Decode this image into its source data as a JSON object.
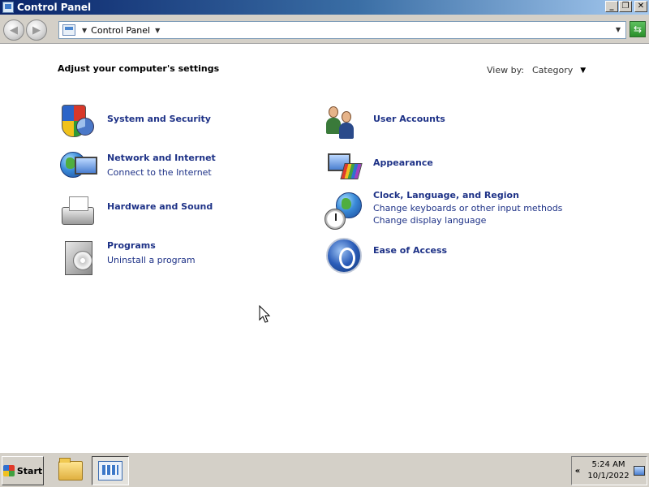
{
  "window": {
    "title": "Control Panel",
    "buttons": {
      "minimize": "_",
      "maximize": "❐",
      "close": "✕"
    }
  },
  "address": {
    "path": "Control Panel",
    "back_icon": "back-arrow-icon",
    "forward_icon": "forward-arrow-icon",
    "refresh_icon": "refresh-icon"
  },
  "content": {
    "heading": "Adjust your computer's settings",
    "view_by_label": "View by:",
    "view_by_value": "Category",
    "categories_left": [
      {
        "title": "System and Security",
        "links": [],
        "icon": "shield-icon"
      },
      {
        "title": "Network and Internet",
        "links": [
          "Connect to the Internet"
        ],
        "icon": "network-globe-icon"
      },
      {
        "title": "Hardware and Sound",
        "links": [],
        "icon": "printer-icon"
      },
      {
        "title": "Programs",
        "links": [
          "Uninstall a program"
        ],
        "icon": "programs-disc-icon"
      }
    ],
    "categories_right": [
      {
        "title": "User Accounts",
        "links": [],
        "icon": "users-icon"
      },
      {
        "title": "Appearance",
        "links": [],
        "icon": "appearance-palette-icon"
      },
      {
        "title": "Clock, Language, and Region",
        "links": [
          "Change keyboards or other input methods",
          "Change display language"
        ],
        "icon": "clock-globe-icon"
      },
      {
        "title": "Ease of Access",
        "links": [],
        "icon": "ease-of-access-icon"
      }
    ]
  },
  "taskbar": {
    "start_label": "Start",
    "tray_arrow": "«",
    "time": "5:24 AM",
    "date": "10/1/2022"
  },
  "colors": {
    "link": "#1e3287",
    "titlebar_start": "#0a246a",
    "titlebar_end": "#a6caf0",
    "chrome": "#d4d0c8"
  }
}
